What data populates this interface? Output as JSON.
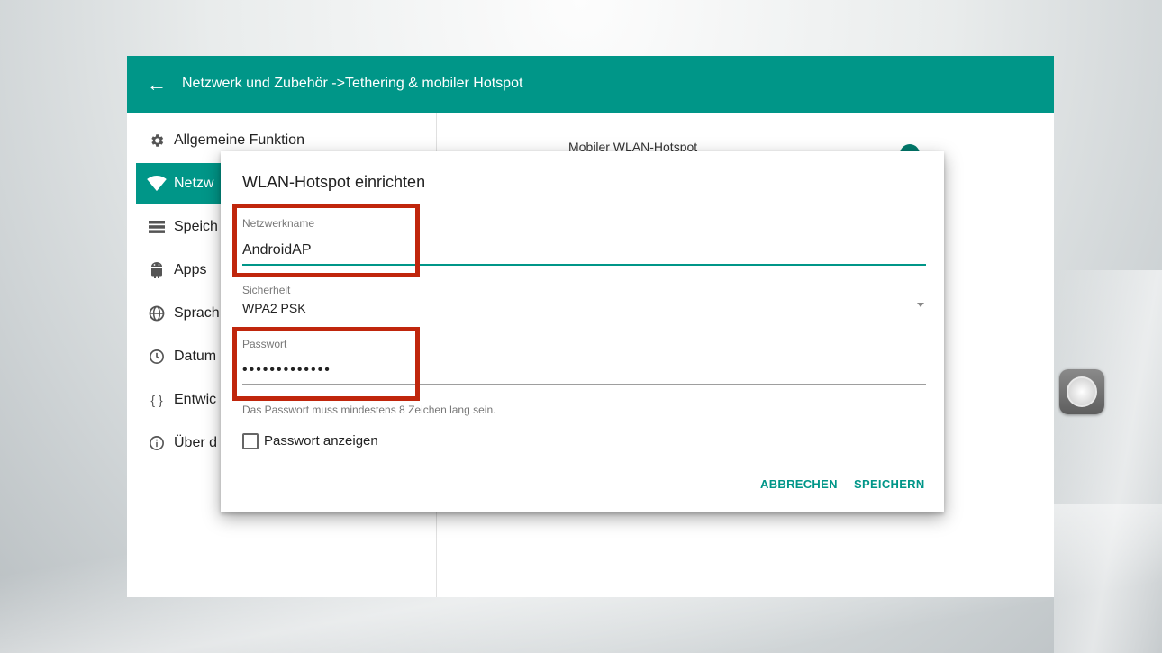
{
  "appbar": {
    "title": "Netzwerk und Zubehör ->Tethering & mobiler Hotspot"
  },
  "sidebar": {
    "items": [
      {
        "label": "Allgemeine Funktion",
        "icon": "gear-icon",
        "active": false
      },
      {
        "label": "Netzw",
        "icon": "wifi-icon",
        "active": true
      },
      {
        "label": "Speich",
        "icon": "storage-icon",
        "active": false
      },
      {
        "label": "Apps",
        "icon": "android-icon",
        "active": false
      },
      {
        "label": "Sprach",
        "icon": "globe-icon",
        "active": false
      },
      {
        "label": "Datum",
        "icon": "clock-icon",
        "active": false
      },
      {
        "label": "Entwic",
        "icon": "code-braces-icon",
        "active": false
      },
      {
        "label": "Über d",
        "icon": "info-icon",
        "active": false
      }
    ]
  },
  "content": {
    "title": "Mobiler WLAN-Hotspot"
  },
  "dialog": {
    "title": "WLAN-Hotspot einrichten",
    "network_name": {
      "label": "Netzwerkname",
      "value": "AndroidAP"
    },
    "security": {
      "label": "Sicherheit",
      "value": "WPA2 PSK"
    },
    "password": {
      "label": "Passwort",
      "value": "•••••••••••••"
    },
    "helper": "Das Passwort muss mindestens 8 Zeichen lang sein.",
    "show_password": {
      "label": "Passwort anzeigen",
      "checked": false
    },
    "cancel_label": "ABBRECHEN",
    "save_label": "SPEICHERN"
  },
  "colors": {
    "accent": "#009688",
    "highlight": "#c0260c"
  }
}
